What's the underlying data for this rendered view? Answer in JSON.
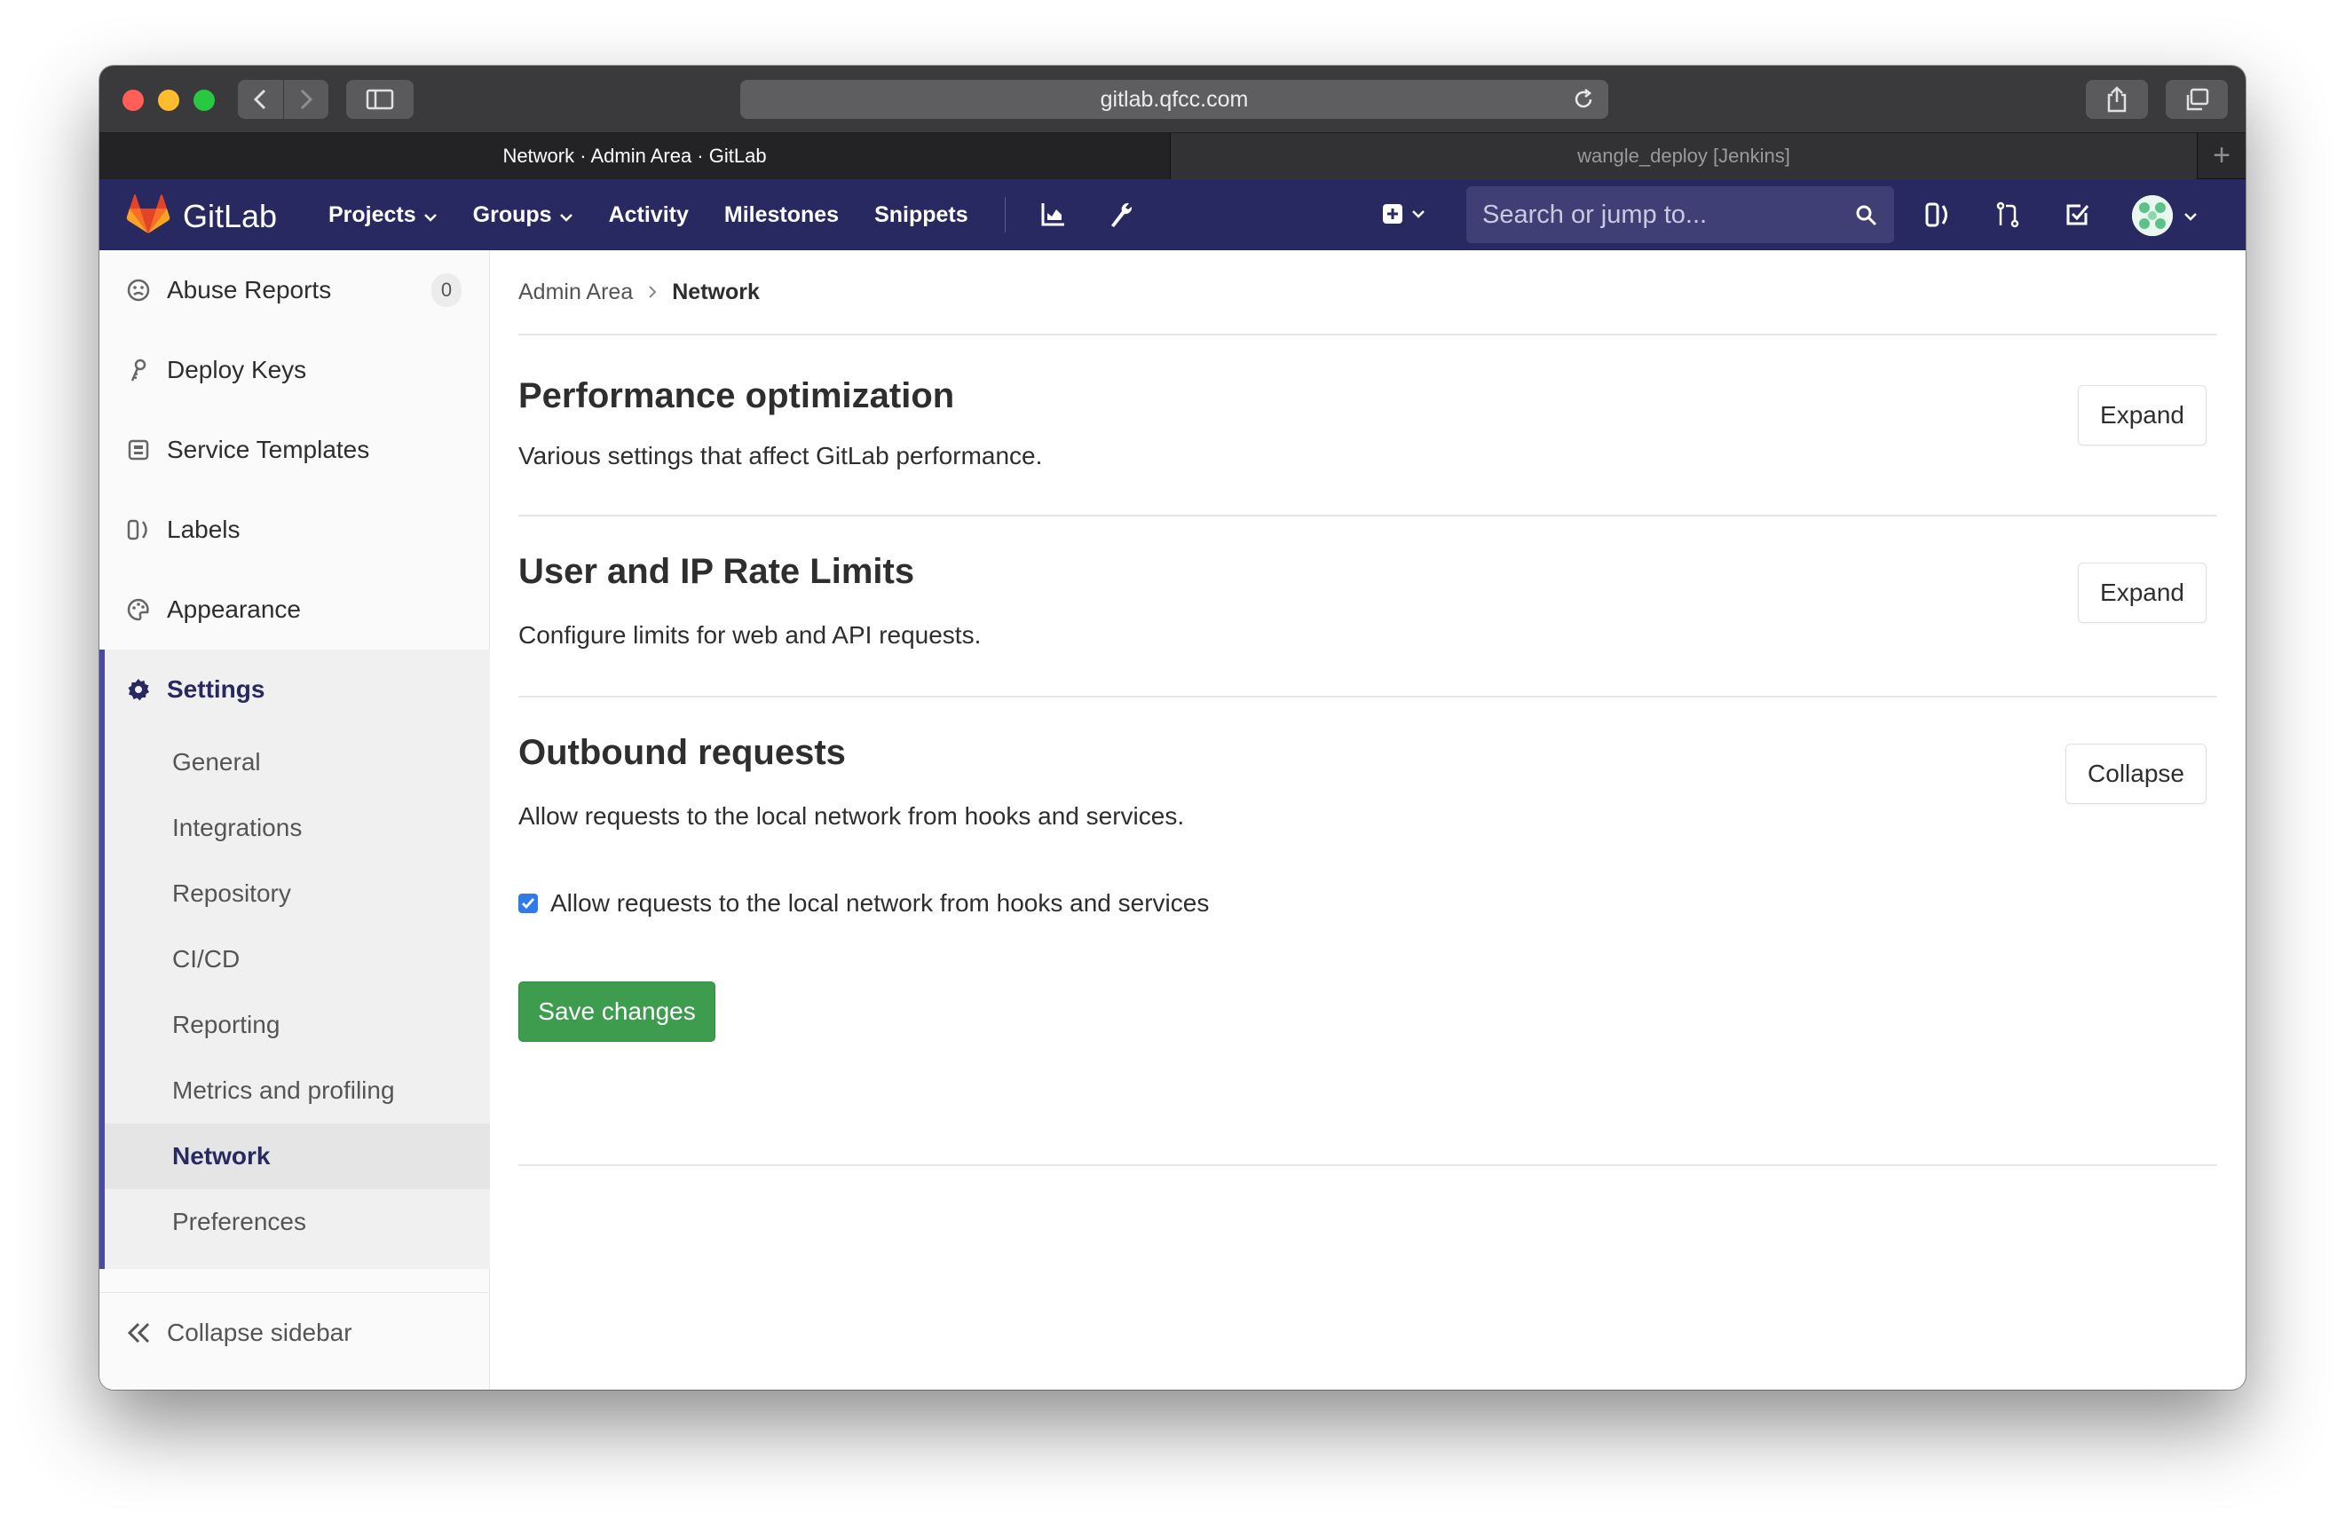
{
  "browser": {
    "url": "gitlab.qfcc.com",
    "tabs": [
      {
        "label": "Network · Admin Area · GitLab",
        "active": true
      },
      {
        "label": "wangle_deploy [Jenkins]",
        "active": false
      }
    ],
    "new_tab_label": "+"
  },
  "navbar": {
    "brand": "GitLab",
    "menu": [
      {
        "label": "Projects",
        "dropdown": true
      },
      {
        "label": "Groups",
        "dropdown": true
      },
      {
        "label": "Activity",
        "dropdown": false
      },
      {
        "label": "Milestones",
        "dropdown": false
      },
      {
        "label": "Snippets",
        "dropdown": false
      }
    ],
    "search_placeholder": "Search or jump to...",
    "colors": {
      "bar": "#292961",
      "search": "#3f3f75"
    }
  },
  "sidebar": {
    "items": [
      {
        "label": "Abuse Reports",
        "icon": "smiley-icon",
        "badge": "0"
      },
      {
        "label": "Deploy Keys",
        "icon": "key-icon"
      },
      {
        "label": "Service Templates",
        "icon": "template-icon"
      },
      {
        "label": "Labels",
        "icon": "labels-icon"
      },
      {
        "label": "Appearance",
        "icon": "palette-icon"
      }
    ],
    "settings": {
      "label": "Settings",
      "icon": "gear-icon",
      "subitems": [
        "General",
        "Integrations",
        "Repository",
        "CI/CD",
        "Reporting",
        "Metrics and profiling",
        "Network",
        "Preferences"
      ],
      "active_subitem": "Network"
    },
    "collapse_label": "Collapse sidebar"
  },
  "breadcrumb": {
    "parent": "Admin Area",
    "current": "Network"
  },
  "sections": [
    {
      "title": "Performance optimization",
      "description": "Various settings that affect GitLab performance.",
      "button": "Expand"
    },
    {
      "title": "User and IP Rate Limits",
      "description": "Configure limits for web and API requests.",
      "button": "Expand"
    },
    {
      "title": "Outbound requests",
      "description": "Allow requests to the local network from hooks and services.",
      "button": "Collapse"
    }
  ],
  "outbound": {
    "checkbox_label": "Allow requests to the local network from hooks and services",
    "checked": true,
    "save_label": "Save changes",
    "save_color": "#3e9c4f"
  }
}
